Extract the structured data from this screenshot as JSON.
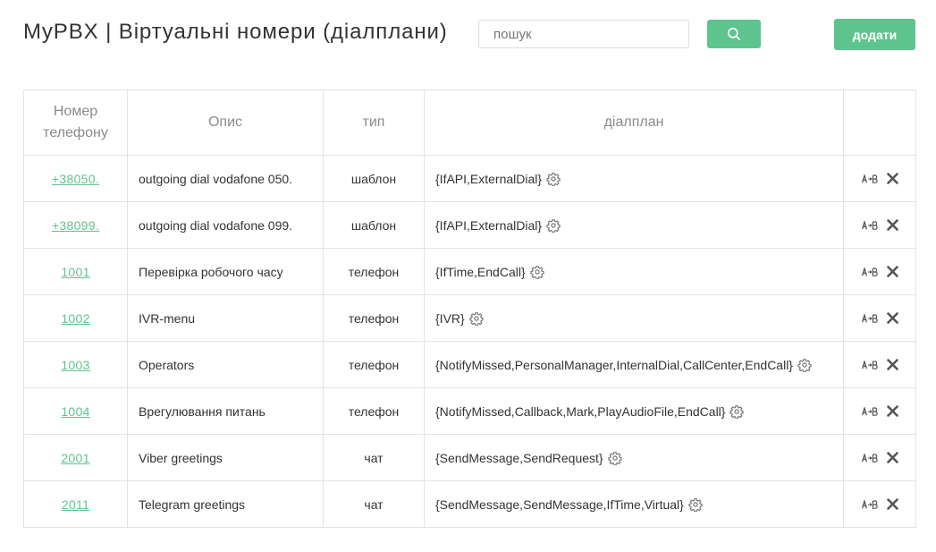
{
  "header": {
    "title": "MyPBX | Віртуальні номери (діалплани)",
    "search_placeholder": "пошук",
    "search_value": "",
    "search_icon": "search-icon",
    "add_label": "додати"
  },
  "colors": {
    "accent": "#5ec48e",
    "border": "#e3e3e3",
    "header_text": "#8a8a8a"
  },
  "table": {
    "headers": {
      "number": "Номер телефону",
      "description": "Опис",
      "type": "тип",
      "dialplan": "діалплан",
      "actions": ""
    },
    "rows": [
      {
        "number": "+38050.",
        "description": "outgoing dial vodafone 050.",
        "type": "шаблон",
        "dialplan": "{IfAPI,ExternalDial}"
      },
      {
        "number": "+38099.",
        "description": "outgoing dial vodafone 099.",
        "type": "шаблон",
        "dialplan": "{IfAPI,ExternalDial}"
      },
      {
        "number": "1001",
        "description": "Перевірка робочого часу",
        "type": "телефон",
        "dialplan": "{IfTime,EndCall}"
      },
      {
        "number": "1002",
        "description": "IVR-menu",
        "type": "телефон",
        "dialplan": "{IVR}"
      },
      {
        "number": "1003",
        "description": "Operators",
        "type": "телефон",
        "dialplan": "{NotifyMissed,PersonalManager,InternalDial,CallCenter,EndCall}"
      },
      {
        "number": "1004",
        "description": "Врегулювання питань",
        "type": "телефон",
        "dialplan": "{NotifyMissed,Callback,Mark,PlayAudioFile,EndCall}"
      },
      {
        "number": "2001",
        "description": "Viber greetings",
        "type": "чат",
        "dialplan": "{SendMessage,SendRequest}"
      },
      {
        "number": "2011",
        "description": "Telegram greetings",
        "type": "чат",
        "dialplan": "{SendMessage,SendMessage,IfTime,Virtual}"
      }
    ],
    "row_icons": [
      "gear-icon",
      "rename-ab-icon",
      "delete-x-icon"
    ]
  }
}
